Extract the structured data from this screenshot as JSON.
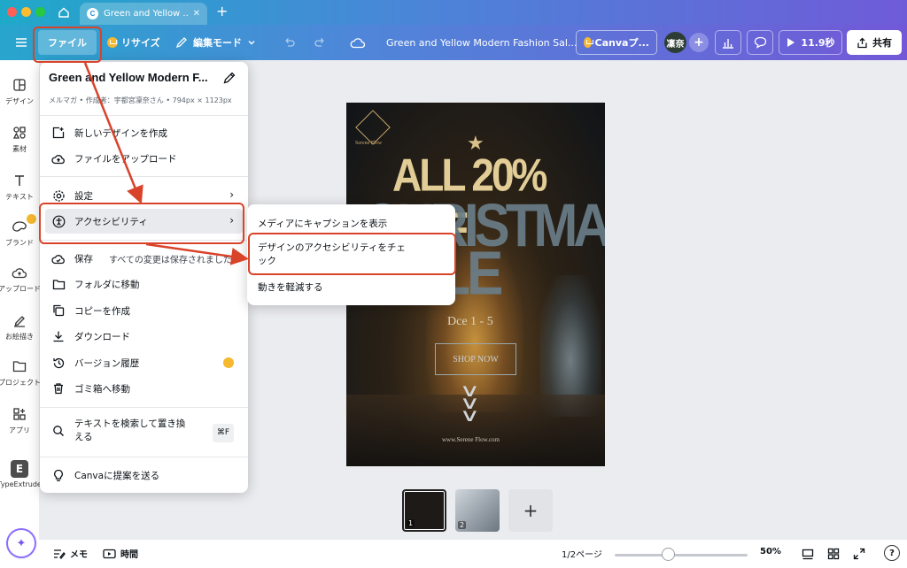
{
  "browser": {
    "tab_title": "Green and Yellow ...",
    "favicon_letter": "C"
  },
  "header": {
    "file_label": "ファイル",
    "resize_label": "リサイズ",
    "edit_mode_label": "編集モード",
    "doc_title": "Green and Yellow Modern Fashion Sal...",
    "canva_pro_label": "Canvaプ...",
    "avatar_text": "凜奈",
    "present_label": "11.9秒",
    "share_label": "共有"
  },
  "rail": {
    "items": [
      {
        "label": "デザイン"
      },
      {
        "label": "素材"
      },
      {
        "label": "テキスト"
      },
      {
        "label": "ブランド"
      },
      {
        "label": "アップロード"
      },
      {
        "label": "お絵描き"
      },
      {
        "label": "プロジェクト"
      },
      {
        "label": "アプリ"
      },
      {
        "label": "TypeExtrude"
      }
    ],
    "typeextrude_letter": "E"
  },
  "file_menu": {
    "title": "Green and Yellow Modern F...",
    "meta": "メルマガ • 作成者：宇都宮凜奈さん • 794px × 1123px",
    "items": {
      "new_design": "新しいデザインを作成",
      "upload": "ファイルをアップロード",
      "settings": "設定",
      "accessibility": "アクセシビリティ",
      "save": "保存",
      "save_status": "すべての変更は保存されました",
      "move_folder": "フォルダに移動",
      "make_copy": "コピーを作成",
      "download": "ダウンロード",
      "version_history": "バージョン履歴",
      "trash": "ゴミ箱へ移動",
      "find_replace": "テキストを検索して置き換える",
      "find_replace_shortcut": "⌘F",
      "suggest": "Canvaに提案を送る"
    }
  },
  "accessibility_submenu": {
    "items": [
      "メディアにキャプションを表示",
      "デザインのアクセシビリティをチェック",
      "動きを軽減する"
    ]
  },
  "canvas_design": {
    "logo_text": "Serene Flow",
    "headline_offer": "ALL 20% OFF",
    "headline_christmas": "CHRISTMAS",
    "headline_sale": "SALE",
    "date": "Dce 1 - 5",
    "shop_button": "SHOP NOW",
    "url": "www.Serene Flow.com"
  },
  "pages": {
    "thumbnails": [
      "1",
      "2"
    ],
    "add_label": "+"
  },
  "bottom_bar": {
    "notes_label": "メモ",
    "timer_label": "時間",
    "page_indicator": "1/2ページ",
    "zoom_label": "50%",
    "zoom_percent": 50,
    "help_label": "?"
  },
  "colors": {
    "header_start": "#27a5cd",
    "header_end": "#7258d7",
    "annotation": "#d8432a",
    "premium_crown": "#f5b82e"
  }
}
